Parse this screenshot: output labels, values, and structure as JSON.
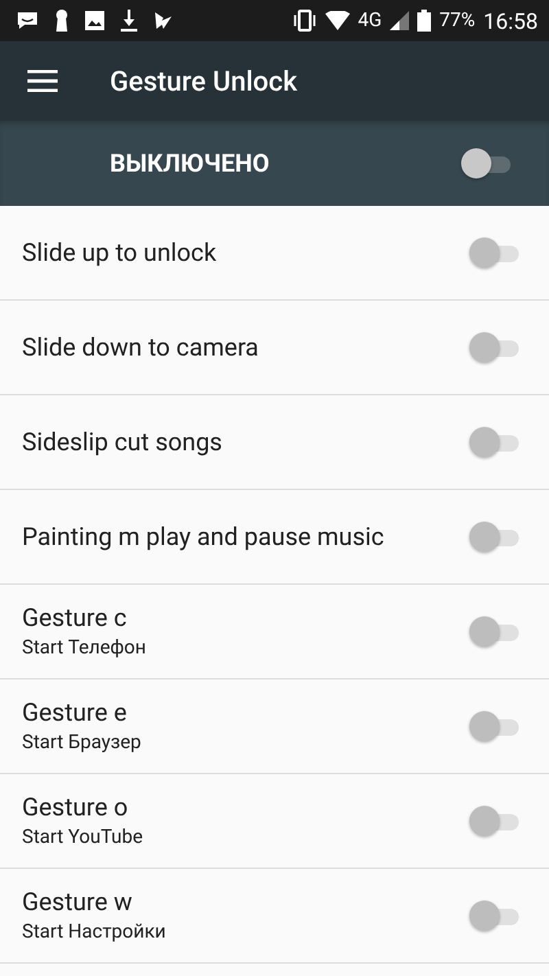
{
  "status_bar": {
    "network": "4G",
    "battery": "77%",
    "time": "16:58"
  },
  "toolbar": {
    "title": "Gesture Unlock"
  },
  "master": {
    "label": "ВЫКЛЮЧЕНО",
    "on": false
  },
  "items": [
    {
      "title": "Slide up to unlock",
      "on": false
    },
    {
      "title": "Slide down to camera",
      "on": false
    },
    {
      "title": "Sideslip cut songs",
      "on": false
    },
    {
      "title": "Painting m play and pause music",
      "on": false
    },
    {
      "title": "Gesture c",
      "subtitle": "Start Телефон",
      "on": false
    },
    {
      "title": "Gesture e",
      "subtitle": "Start Браузер",
      "on": false
    },
    {
      "title": "Gesture o",
      "subtitle": "Start YouTube",
      "on": false
    },
    {
      "title": "Gesture w",
      "subtitle": "Start Настройки",
      "on": false
    }
  ]
}
